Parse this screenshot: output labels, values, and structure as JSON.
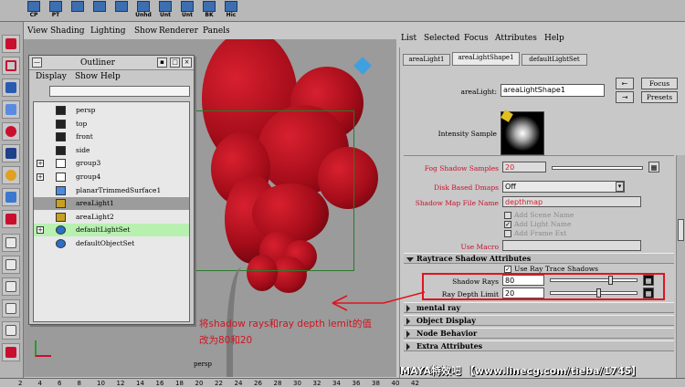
{
  "shelf": {
    "items": [
      {
        "label": "CP",
        "icon": "cp-icon"
      },
      {
        "label": "PT",
        "icon": "pt-icon"
      },
      {
        "label": "",
        "icon": "surface-icon"
      },
      {
        "label": "",
        "icon": "nurbs-icon"
      },
      {
        "label": "",
        "icon": "deform-icon"
      },
      {
        "label": "Unhd",
        "icon": "unhide-icon"
      },
      {
        "label": "Unt",
        "icon": "unt-icon"
      },
      {
        "label": "Unt",
        "icon": "unt2-icon"
      },
      {
        "label": "BK",
        "icon": "bake-icon"
      },
      {
        "label": "Hic",
        "icon": "hic-icon"
      }
    ]
  },
  "view_menu": [
    "View",
    "Shading",
    "Lighting",
    "Show",
    "Renderer",
    "Panels"
  ],
  "outliner": {
    "title": "Outliner",
    "menu": [
      "Display",
      "Show",
      "Help"
    ],
    "items": [
      {
        "label": "persp",
        "icon": "camera-icon",
        "expand": false,
        "state": ""
      },
      {
        "label": "top",
        "icon": "camera-icon",
        "expand": false,
        "state": ""
      },
      {
        "label": "front",
        "icon": "camera-icon",
        "expand": false,
        "state": ""
      },
      {
        "label": "side",
        "icon": "camera-icon",
        "expand": false,
        "state": ""
      },
      {
        "label": "group3",
        "icon": "group-icon",
        "expand": true,
        "state": ""
      },
      {
        "label": "group4",
        "icon": "group-icon",
        "expand": true,
        "state": ""
      },
      {
        "label": "planarTrimmedSurface1",
        "icon": "surface-icon",
        "expand": false,
        "state": ""
      },
      {
        "label": "areaLight1",
        "icon": "light-icon",
        "expand": false,
        "state": "selected"
      },
      {
        "label": "areaLight2",
        "icon": "light-icon",
        "expand": false,
        "state": ""
      },
      {
        "label": "defaultLightSet",
        "icon": "set-icon",
        "expand": true,
        "state": "highlight"
      },
      {
        "label": "defaultObjectSet",
        "icon": "set-icon",
        "expand": false,
        "state": ""
      }
    ]
  },
  "attr_editor": {
    "menu": [
      "List",
      "Selected",
      "Focus",
      "Attributes",
      "Help"
    ],
    "tabs": [
      "areaLight1",
      "areaLightShape1",
      "defaultLightSet"
    ],
    "active_tab": 1,
    "node_label": "areaLight:",
    "node_value": "areaLightShape1",
    "focus_btn": "Focus",
    "presets_btn": "Presets",
    "intensity_sample_label": "Intensity Sample",
    "fog_shadow_samples_label": "Fog Shadow Samples",
    "fog_shadow_samples_value": "20",
    "disk_based_dmaps_label": "Disk Based Dmaps",
    "disk_based_dmaps_value": "Off",
    "shadow_map_file_label": "Shadow Map File Name",
    "shadow_map_file_value": "depthmap",
    "add_scene_name": "Add Scene Name",
    "add_light_name": "Add Light Name",
    "add_frame_ext": "Add Frame Ext",
    "use_macro_label": "Use Macro",
    "raytrace_section": "Raytrace Shadow Attributes",
    "use_ray_trace_shadows": "Use Ray Trace Shadows",
    "use_ray_trace_checked": true,
    "shadow_rays_label": "Shadow Rays",
    "shadow_rays_value": "80",
    "shadow_rays_level": 0.7,
    "ray_depth_label": "Ray Depth Limit",
    "ray_depth_value": "20",
    "ray_depth_level": 0.55,
    "sections_collapsed": [
      "mental ray",
      "Object Display",
      "Node Behavior",
      "Extra Attributes"
    ]
  },
  "annotation": {
    "line1": "将shadow rays和ray depth lemit的值",
    "line2": "改为80和20"
  },
  "watermark": "MAYA特效吧 【www.linecg.com/tieba/1745】",
  "viewport_label": "persp",
  "timeline": {
    "ticks": [
      "2",
      "4",
      "6",
      "8",
      "10",
      "12",
      "14",
      "16",
      "18",
      "20",
      "22",
      "24",
      "26",
      "28",
      "30",
      "32",
      "34",
      "36",
      "38",
      "40",
      "42"
    ]
  },
  "colors": {
    "accent_red": "#d1141e",
    "balloon_red": "#a60d1a",
    "selection_gray": "#9c9c9c",
    "highlight_green": "#b8f0b0"
  }
}
